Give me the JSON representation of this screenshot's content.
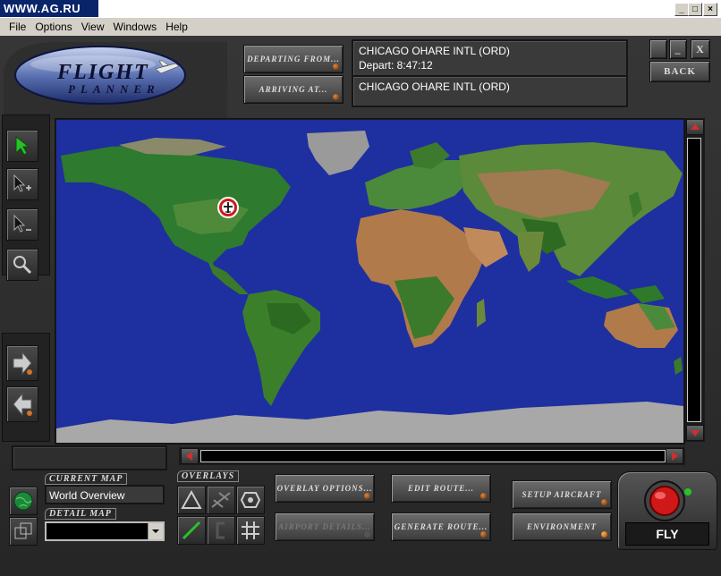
{
  "window": {
    "title": "WWW.AG.RU",
    "controls": [
      "_",
      "□",
      "X"
    ]
  },
  "menu": [
    "File",
    "Options",
    "View",
    "Windows",
    "Help"
  ],
  "logo": {
    "line1": "FLIGHT",
    "line2": "PLANNER"
  },
  "route": {
    "departing_label": "DEPARTING FROM...",
    "arriving_label": "ARRIVING AT...",
    "departing_airport": "CHICAGO OHARE INTL (ORD)",
    "depart_time": "Depart: 8:47:12",
    "arriving_airport": "CHICAGO OHARE INTL (ORD)"
  },
  "top_right": {
    "min_label": "_",
    "close_label": "X",
    "back_label": "BACK"
  },
  "tools": [
    "select-tool",
    "add-waypoint-tool",
    "remove-waypoint-tool",
    "zoom-tool",
    "forward-tool",
    "back-tool"
  ],
  "maps": {
    "current_map_label": "CURRENT MAP",
    "current_map_value": "World Overview",
    "detail_map_label": "DETAIL MAP",
    "detail_map_value": ""
  },
  "overlays": {
    "label": "OVERLAYS",
    "items": [
      "airports",
      "airways",
      "vor",
      "route",
      "ils",
      "grid"
    ]
  },
  "buttons": {
    "overlay_options": "OVERLAY OPTIONS...",
    "edit_route": "EDIT ROUTE...",
    "setup_aircraft": "SETUP AIRCRAFT",
    "airport_details": "AIRPORT DETAILS...",
    "generate_route": "GENERATE ROUTE...",
    "environment": "ENVIRONMENT",
    "fly": "FLY"
  },
  "colors": {
    "ocean": "#1e2fa0",
    "panel": "#2b2b2b",
    "accent": "#e07a2a",
    "fly_red": "#d01818",
    "tool_active": "#29c229"
  }
}
